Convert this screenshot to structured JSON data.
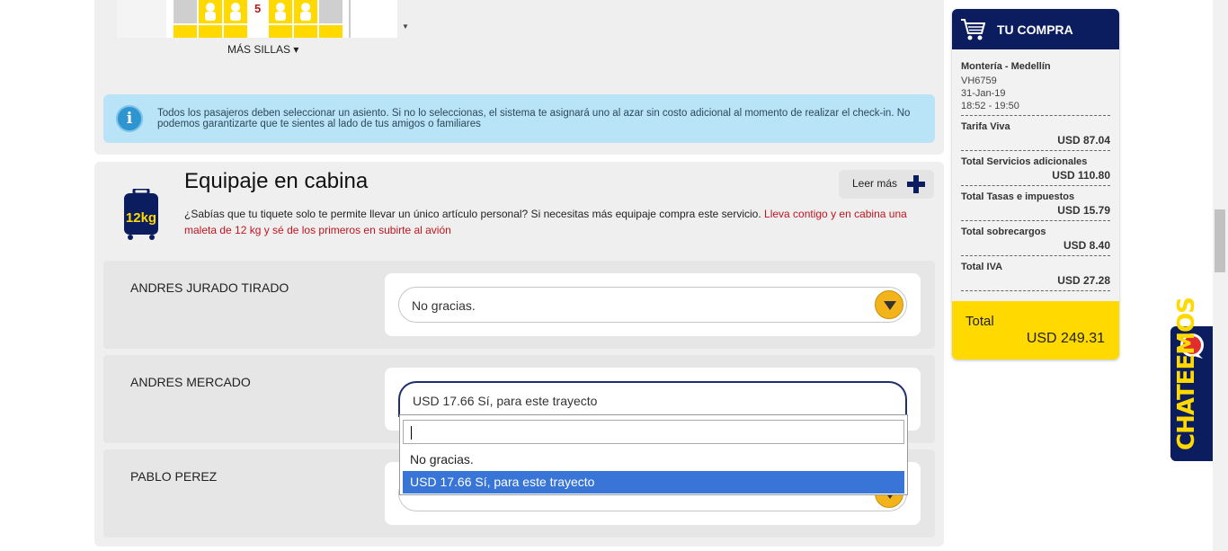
{
  "seatmap": {
    "row_number": "5",
    "more_seats_label": "MÁS SILLAS ▾"
  },
  "info": {
    "text": "Todos los pasajeros deben seleccionar un asiento. Si no lo seleccionas, el sistema te asignará uno al azar sin costo adicional al momento de realizar el check-in. No podemos garantizarte que te sientes al lado de tus amigos o familiares"
  },
  "cabin_baggage": {
    "icon_label": "12kg",
    "title": "Equipaje en cabina",
    "desc_black": "¿Sabías que tu tiquete solo te permite llevar un único artículo personal? Si necesitas más equipaje compra este servicio. ",
    "desc_red": "Lleva contigo y en cabina una maleta de 12 kg y sé de los primeros en subirte al avión",
    "read_more_label": "Leer más"
  },
  "passengers": [
    {
      "name": "ANDRES JURADO TIRADO",
      "selection": "No gracias."
    },
    {
      "name": "ANDRES MERCADO",
      "selection": "USD 17.66 Sí, para este trayecto"
    },
    {
      "name": "PABLO PEREZ",
      "selection": ""
    }
  ],
  "dropdown": {
    "search_value": "",
    "options": [
      "No gracias.",
      "USD 17.66 Sí, para este trayecto"
    ],
    "selected_index": 1
  },
  "purchase": {
    "title": "TU COMPRA",
    "route": "Montería - Medellín",
    "flight": "VH6759",
    "date": "31-Jan-19",
    "time": "18:52 - 19:50",
    "lines": [
      {
        "label": "Tarifa Viva",
        "amount": "USD 87.04"
      },
      {
        "label": "Total Servicios adicionales",
        "amount": "USD 110.80"
      },
      {
        "label": "Total Tasas e impuestos",
        "amount": "USD 15.79"
      },
      {
        "label": "Total sobrecargos",
        "amount": "USD 8.40"
      },
      {
        "label": "Total IVA",
        "amount": "USD 27.28"
      }
    ],
    "total_label": "Total",
    "total_amount": "USD 249.31"
  },
  "chat": {
    "label": "CHATEEMOS"
  },
  "colors": {
    "navy": "#0b1d5e",
    "yellow": "#ffd900",
    "info_bg": "#b9e3f6",
    "link_red": "#c0141e",
    "select_blue": "#3875d7"
  }
}
